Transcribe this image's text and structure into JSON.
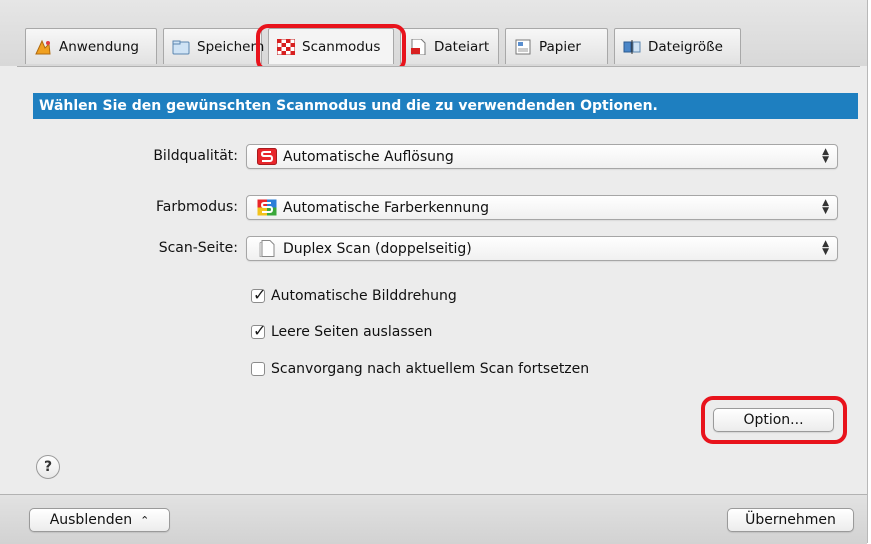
{
  "tabs": [
    {
      "label": "Anwendung",
      "icon": "application-icon",
      "active": false
    },
    {
      "label": "Speichern",
      "icon": "folder-icon",
      "active": false
    },
    {
      "label": "Scanmodus",
      "icon": "scanmode-checker-icon",
      "active": true
    },
    {
      "label": "Dateiart",
      "icon": "pdf-file-icon",
      "active": false
    },
    {
      "label": "Papier",
      "icon": "paper-icon",
      "active": false
    },
    {
      "label": "Dateigröße",
      "icon": "filesize-icon",
      "active": false
    }
  ],
  "banner": "Wählen Sie den gewünschten Scanmodus und die zu verwendenden Optionen.",
  "fields": {
    "quality": {
      "label": "Bildqualität:",
      "value": "Automatische Auflösung",
      "icon": "auto-resolution-icon"
    },
    "color": {
      "label": "Farbmodus:",
      "value": "Automatische Farberkennung",
      "icon": "auto-color-icon"
    },
    "side": {
      "label": "Scan-Seite:",
      "value": "Duplex Scan (doppelseitig)",
      "icon": "duplex-page-icon"
    }
  },
  "checkboxes": [
    {
      "label": "Automatische Bilddrehung",
      "checked": true
    },
    {
      "label": "Leere Seiten auslassen",
      "checked": true
    },
    {
      "label": "Scanvorgang nach aktuellem Scan fortsetzen",
      "checked": false
    }
  ],
  "buttons": {
    "option": "Option...",
    "hide": "Ausblenden",
    "apply": "Übernehmen",
    "help": "?"
  },
  "colors": {
    "banner": "#1e7fc0",
    "highlight": "#e8131c"
  }
}
